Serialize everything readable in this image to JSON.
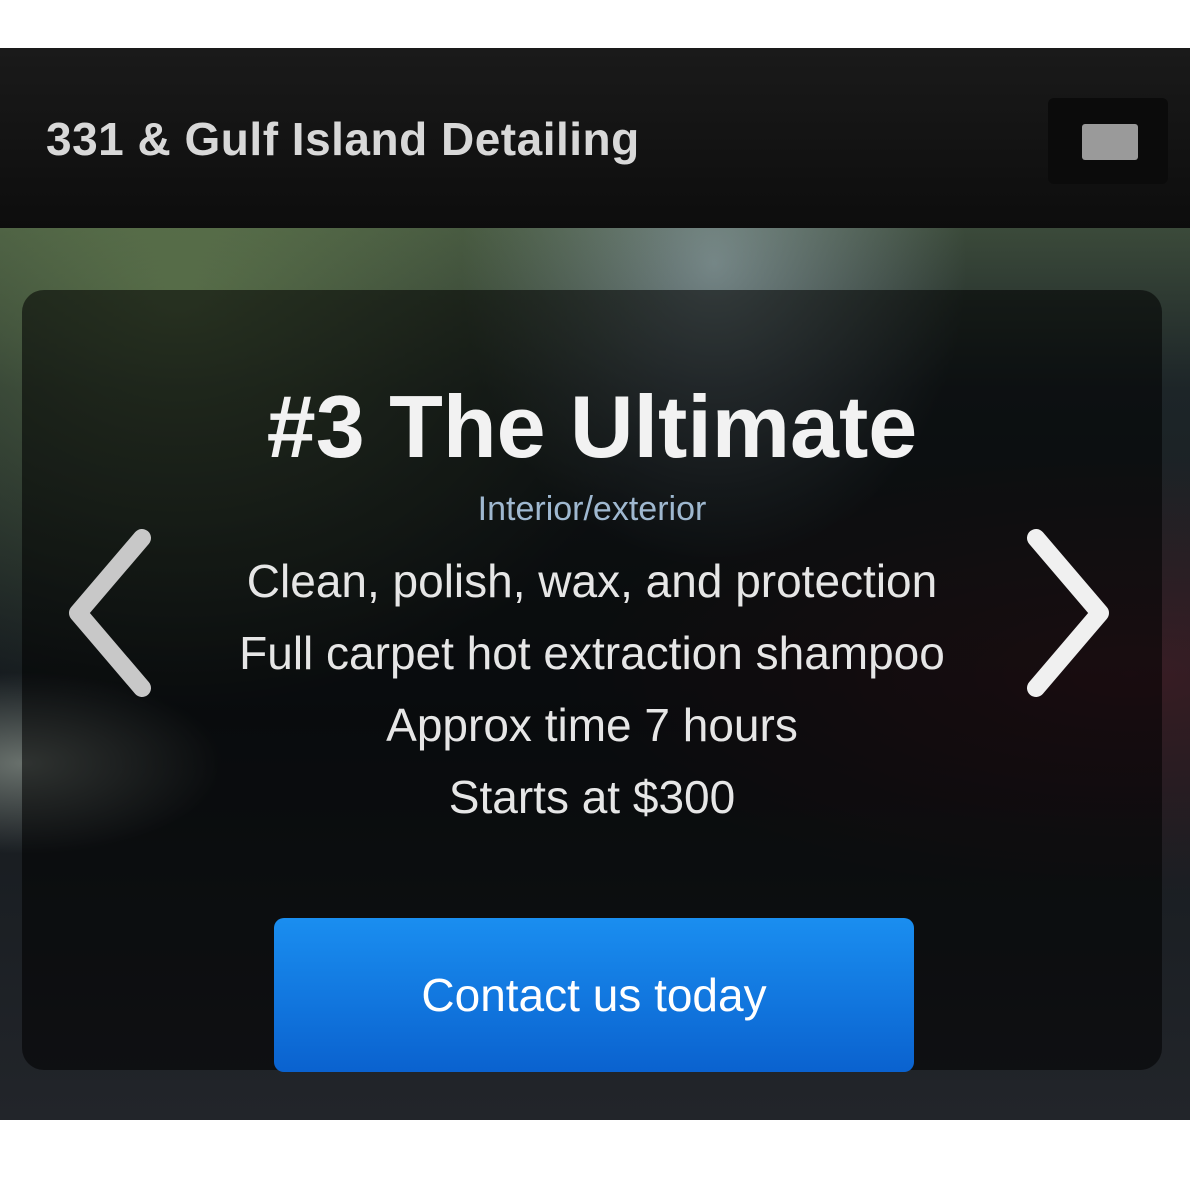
{
  "navbar": {
    "brand": "331 & Gulf Island Detailing",
    "menu_icon": "hamburger-icon"
  },
  "carousel": {
    "title": "#3 The Ultimate",
    "subtitle": "Interior/exterior",
    "lines": [
      "Clean, polish, wax, and protection",
      "Full carpet hot extraction shampoo",
      "Approx time 7 hours",
      "Starts at $300"
    ],
    "button_label": "Contact us today",
    "prev_icon": "chevron-left-icon",
    "next_icon": "chevron-right-icon"
  },
  "colors": {
    "navbar": "#101010",
    "button": "#1478e0",
    "text": "#ffffff"
  }
}
